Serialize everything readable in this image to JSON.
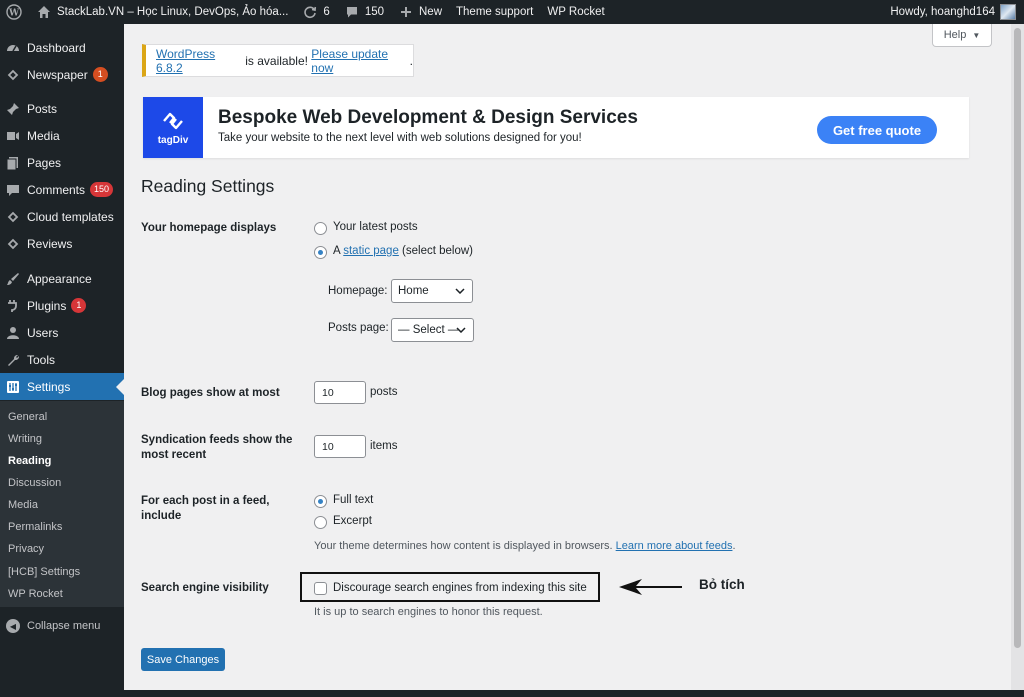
{
  "adminbar": {
    "site_name": "StackLab.VN – Học Linux, DevOps, Ảo hóa...",
    "updates_count": "6",
    "comments_count": "150",
    "new_label": "New",
    "theme_support": "Theme support",
    "wp_rocket": "WP Rocket",
    "howdy": "Howdy, hoanghd164"
  },
  "sidebar": {
    "items": [
      {
        "label": "Dashboard",
        "icon": "dashboard-icon"
      },
      {
        "label": "Newspaper",
        "icon": "newspaper-icon",
        "badge": "1"
      },
      {
        "label": "Posts",
        "icon": "pin-icon"
      },
      {
        "label": "Media",
        "icon": "media-icon"
      },
      {
        "label": "Pages",
        "icon": "pages-icon"
      },
      {
        "label": "Comments",
        "icon": "comment-icon",
        "badge": "150"
      },
      {
        "label": "Cloud templates",
        "icon": "cloud-templates-icon"
      },
      {
        "label": "Reviews",
        "icon": "reviews-icon"
      },
      {
        "label": "Appearance",
        "icon": "brush-icon"
      },
      {
        "label": "Plugins",
        "icon": "plugin-icon",
        "badge": "1"
      },
      {
        "label": "Users",
        "icon": "user-icon"
      },
      {
        "label": "Tools",
        "icon": "wrench-icon"
      },
      {
        "label": "Settings",
        "icon": "settings-icon"
      }
    ],
    "submenu": [
      "General",
      "Writing",
      "Reading",
      "Discussion",
      "Media",
      "Permalinks",
      "Privacy",
      "[HCB] Settings",
      "WP Rocket"
    ],
    "collapse_label": "Collapse menu"
  },
  "help_label": "Help",
  "update_nag": {
    "version_link": "WordPress 6.8.2",
    "middle": " is available! ",
    "update_link": "Please update now",
    "end": "."
  },
  "banner": {
    "logo_text": "tagDiv",
    "title": "Bespoke Web Development & Design Services",
    "subtitle": "Take your website to the next level with web solutions designed for you!",
    "cta": "Get free quote"
  },
  "page_title": "Reading Settings",
  "homepage_displays": {
    "label": "Your homepage displays",
    "option_latest": "Your latest posts",
    "option_static_prefix": "A ",
    "option_static_link": "static page",
    "option_static_suffix": " (select below)",
    "selected": "static",
    "homepage_label": "Homepage:",
    "homepage_value": "Home",
    "posts_page_label": "Posts page:",
    "posts_page_value": "— Select —"
  },
  "blog_pages": {
    "label": "Blog pages show at most",
    "value": "10",
    "unit": "posts"
  },
  "syndication": {
    "label_line1": "Syndication feeds show the",
    "label_line2": "most recent",
    "value": "10",
    "unit": "items"
  },
  "feed_include": {
    "label_line1": "For each post in a feed,",
    "label_line2": "include",
    "option_full": "Full text",
    "option_excerpt": "Excerpt",
    "selected": "full",
    "desc_prefix": "Your theme determines how content is displayed in browsers. ",
    "desc_link": "Learn more about feeds",
    "desc_end": "."
  },
  "search_visibility": {
    "label": "Search engine visibility",
    "checkbox_label": "Discourage search engines from indexing this site",
    "checked": false,
    "desc": "It is up to search engines to honor this request."
  },
  "annotation": "Bỏ tích",
  "save_button": "Save Changes",
  "colors": {
    "admin_dark": "#1d2327",
    "accent": "#2271b1",
    "badge": "#d63638",
    "banner_cta": "#3b82f6",
    "tagdiv_blue": "#1d49e8",
    "notice_yellow": "#dba617"
  }
}
